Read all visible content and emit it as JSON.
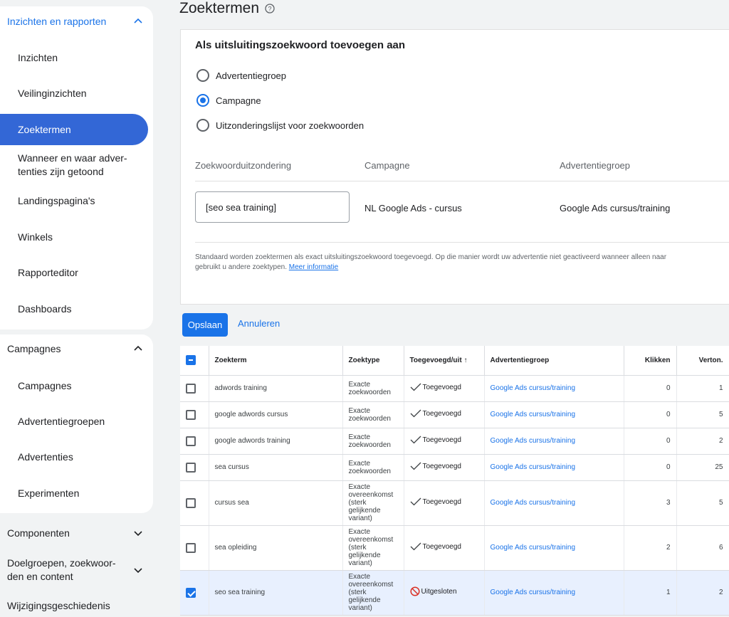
{
  "sidebar": {
    "section1": {
      "header": "Inzichten en rapporten",
      "items": [
        "Inzichten",
        "Veilinginzichten",
        "Zoektermen",
        "Wanneer en waar adver-\ntenties zijn getoond",
        "Landingspagina's",
        "Winkels",
        "Rapporteditor",
        "Dashboards"
      ]
    },
    "section2": {
      "header": "Campagnes",
      "items": [
        "Campagnes",
        "Advertentiegroepen",
        "Advertenties",
        "Experimenten"
      ]
    },
    "section3": {
      "header": "Componenten"
    },
    "section4": {
      "header_line1": "Doelgroepen, zoekwoor-",
      "header_line2": "den en content"
    },
    "section5": {
      "header": "Wijzigingsgeschiedenis"
    }
  },
  "page": {
    "title": "Zoektermen"
  },
  "panel": {
    "title": "Als uitsluitingszoekwoord toevoegen aan",
    "options": [
      "Advertentiegroep",
      "Campagne",
      "Uitzonderingslijst voor zoekwoorden"
    ],
    "selected_option": "Campagne",
    "columns": [
      "Zoekwoorduitzondering",
      "Campagne",
      "Advertentiegroep"
    ],
    "keyword_value": "[seo sea training]",
    "campaign_value": "NL Google Ads - cursus",
    "adgroup_value": "Google Ads cursus/training",
    "note_line1": "Standaard worden zoektermen als exact uitsluitingszoekwoord toegevoegd. Op die manier wordt uw advertentie niet geactiveerd wanneer alleen naar",
    "note_line2": "gebruikt u andere zoektypen.",
    "note_link": "Meer informatie"
  },
  "buttons": {
    "save": "Opslaan",
    "cancel": "Annuleren"
  },
  "table": {
    "headers": [
      "Zoekterm",
      "Zoektype",
      "Toegevoegd/uit",
      "Advertentiegroep",
      "Klikken",
      "Verton."
    ],
    "rows": [
      {
        "term": "adwords training",
        "type": "Exacte zoekwoorden",
        "status": "Toegevoegd",
        "adgroup": "Google Ads cursus/training",
        "clicks": "0",
        "impr": "1",
        "checked": false
      },
      {
        "term": "google adwords cursus",
        "type": "Exacte zoekwoorden",
        "status": "Toegevoegd",
        "adgroup": "Google Ads cursus/training",
        "clicks": "0",
        "impr": "5",
        "checked": false
      },
      {
        "term": "google adwords training",
        "type": "Exacte zoekwoorden",
        "status": "Toegevoegd",
        "adgroup": "Google Ads cursus/training",
        "clicks": "0",
        "impr": "2",
        "checked": false
      },
      {
        "term": "sea cursus",
        "type": "Exacte zoekwoorden",
        "status": "Toegevoegd",
        "adgroup": "Google Ads cursus/training",
        "clicks": "0",
        "impr": "25",
        "checked": false
      },
      {
        "term": "cursus sea",
        "type": "Exacte overeenkomst (sterk gelijkende variant)",
        "status": "Toegevoegd",
        "adgroup": "Google Ads cursus/training",
        "clicks": "3",
        "impr": "5",
        "checked": false
      },
      {
        "term": "sea opleiding",
        "type": "Exacte overeenkomst (sterk gelijkende variant)",
        "status": "Toegevoegd",
        "adgroup": "Google Ads cursus/training",
        "clicks": "2",
        "impr": "6",
        "checked": false
      },
      {
        "term": "seo sea training",
        "type": "Exacte overeenkomst (sterk gelijkende variant)",
        "status": "Uitgesloten",
        "adgroup": "Google Ads cursus/training",
        "clicks": "1",
        "impr": "2",
        "checked": true
      }
    ]
  },
  "colors": {
    "accent": "#1a73e8",
    "selected_nav": "#3367d6",
    "excluded": "#d93025"
  }
}
